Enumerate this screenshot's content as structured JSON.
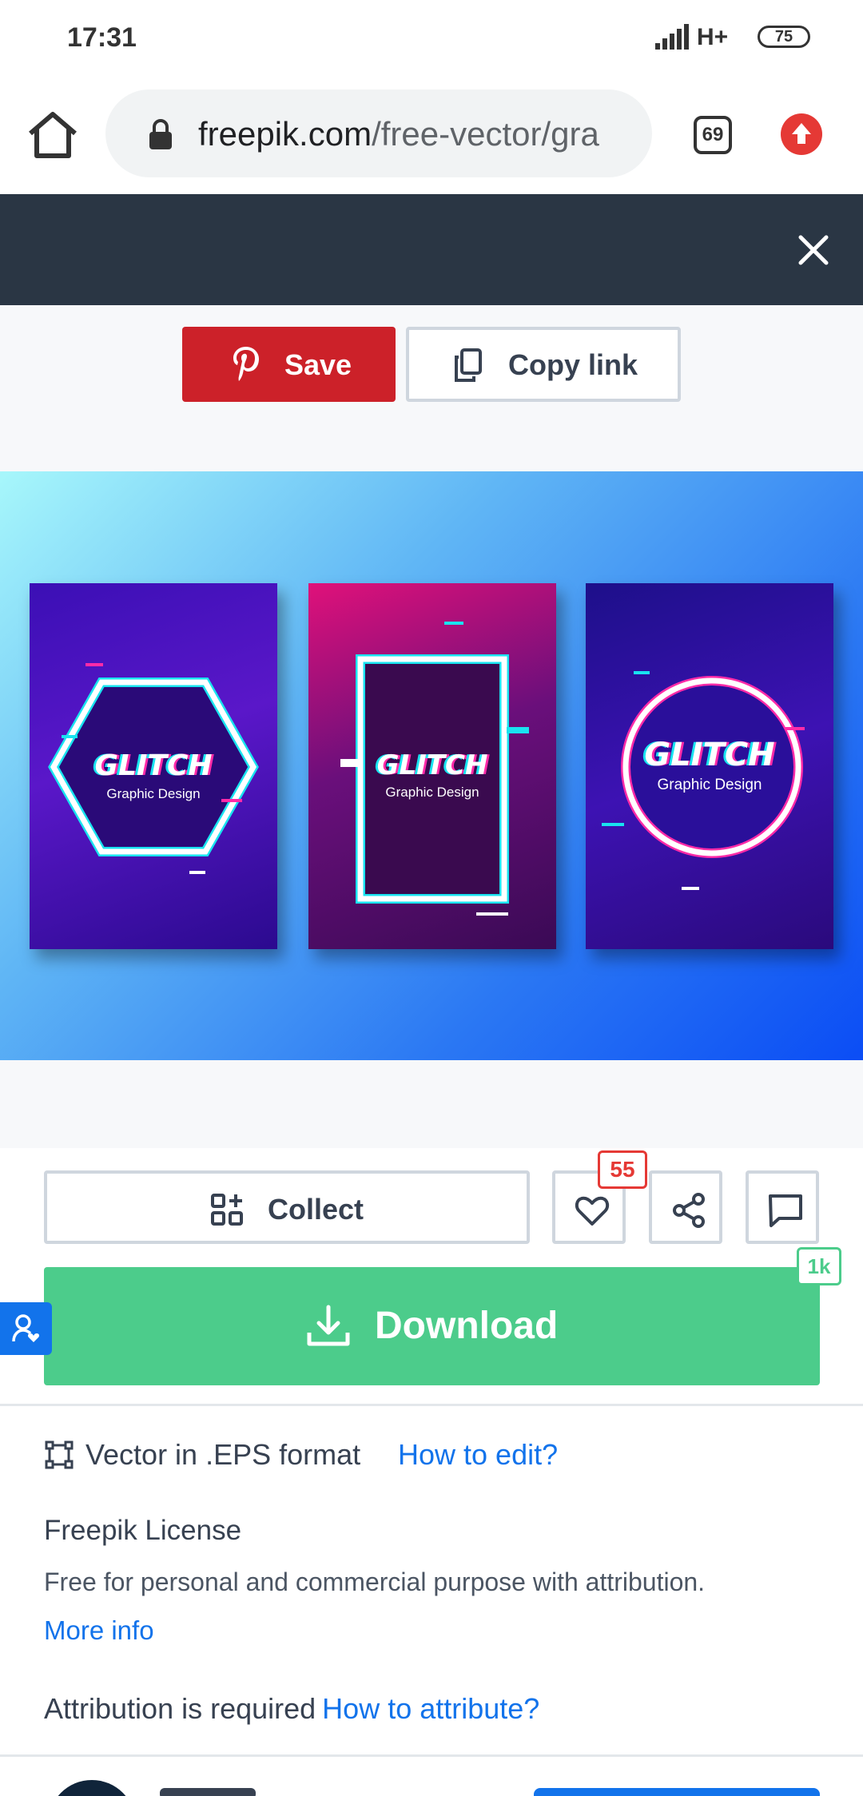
{
  "status_bar": {
    "time": "17:31",
    "network": "H+",
    "battery": "75"
  },
  "browser": {
    "url_host": "freepik.com",
    "url_path": "/free-vector/gra",
    "tab_count": "69"
  },
  "share": {
    "save_label": "Save",
    "copy_label": "Copy link"
  },
  "preview": {
    "posters": [
      {
        "title": "GLITCH",
        "subtitle": "Graphic Design"
      },
      {
        "title": "GLITCH",
        "subtitle": "Graphic Design"
      },
      {
        "title": "GLITCH",
        "subtitle": "Graphic Design"
      }
    ]
  },
  "actions": {
    "collect_label": "Collect",
    "like_count": "55",
    "download_label": "Download",
    "download_count": "1k"
  },
  "info": {
    "format_text": "Vector in .EPS format",
    "how_to_edit": "How to edit?",
    "license_title": "Freepik License",
    "license_desc": "Free for personal and commercial purpose with attribution.",
    "more_info": "More info",
    "attribution_text": "Attribution is required",
    "how_to_attribute": "How to attribute?"
  },
  "colors": {
    "save_red": "#cc2129",
    "download_green": "#4ccc8b",
    "link_blue": "#1273eb",
    "banner_dark": "#2a3644"
  }
}
